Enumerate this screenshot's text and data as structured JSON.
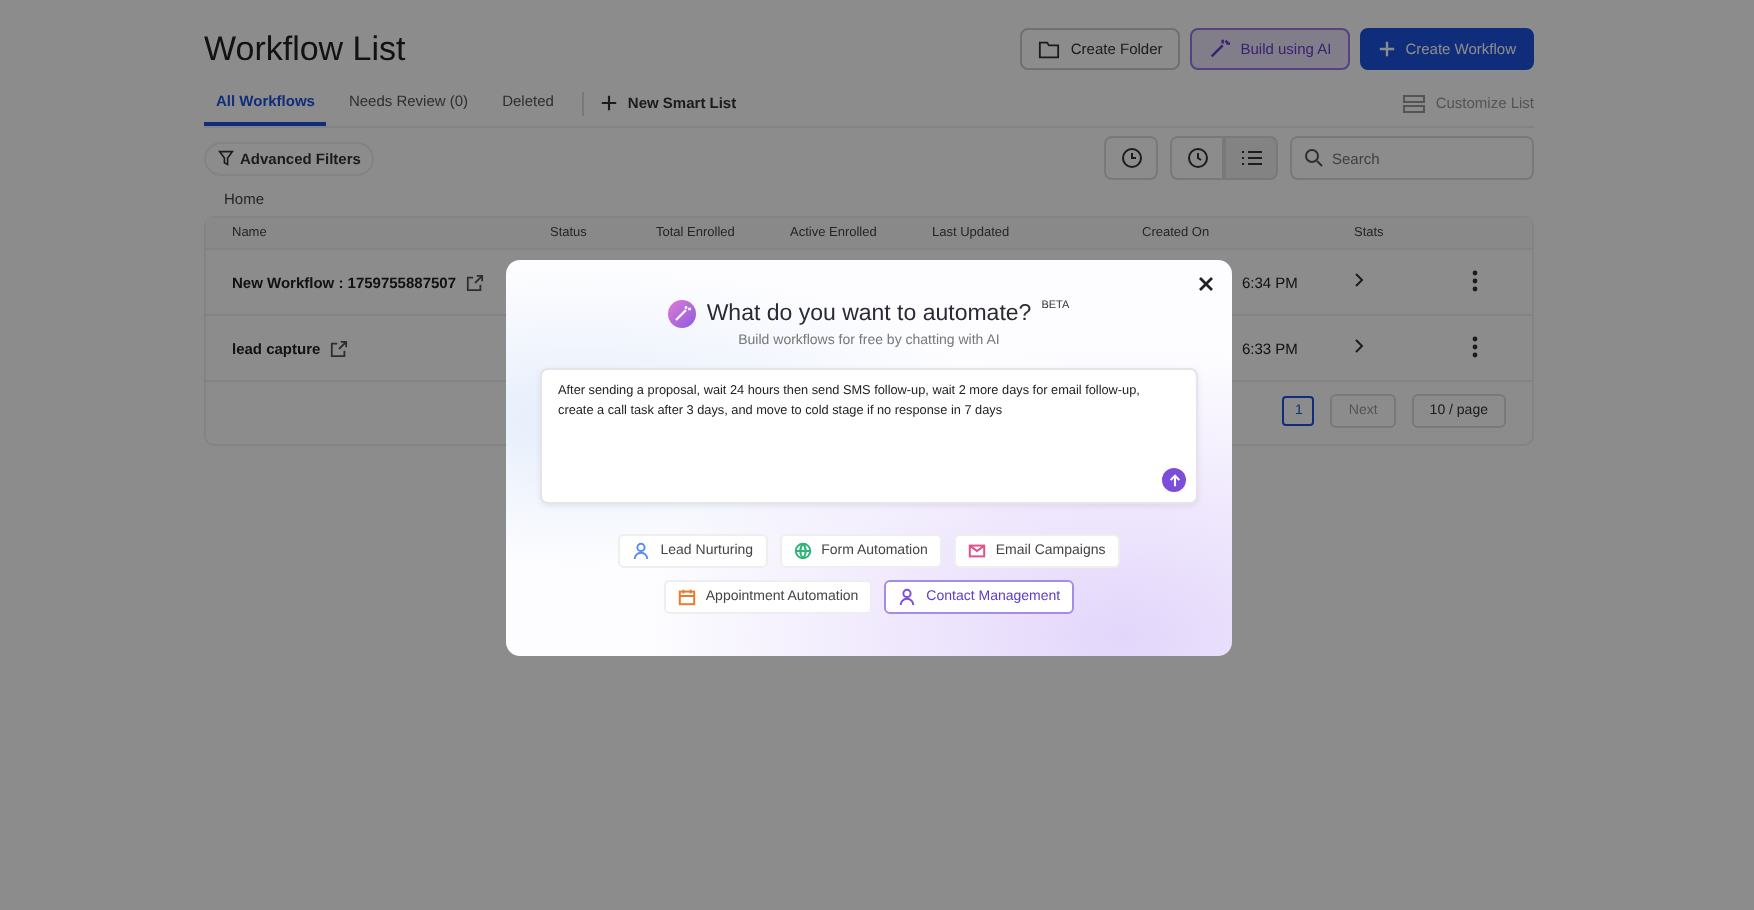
{
  "page": {
    "title": "Workflow List",
    "header_buttons": [
      {
        "label": "Create Folder",
        "kind": "folder"
      },
      {
        "label": "Build using AI",
        "kind": "ai"
      },
      {
        "label": "Create Workflow",
        "kind": "primary"
      }
    ],
    "tabs": [
      {
        "label": "All Workflows",
        "selected": true
      },
      {
        "label": "Needs Review (0)",
        "selected": false
      },
      {
        "label": "Deleted",
        "selected": false
      }
    ],
    "new_smart_list": "New Smart List",
    "customize_list": "Customize List",
    "advanced_filters": "Advanced Filters",
    "search": {
      "placeholder": "Search"
    },
    "breadcrumb": "Home",
    "table": {
      "columns": [
        "Name",
        "Status",
        "Total Enrolled",
        "Active Enrolled",
        "Last Updated",
        "Created On",
        "Stats"
      ],
      "rows": [
        {
          "name": "New Workflow : 1759755887507",
          "created_on": "6:34 PM"
        },
        {
          "name": "lead capture",
          "created_on": "6:33 PM"
        }
      ]
    },
    "pagination": {
      "page": "1",
      "next": "Next",
      "page_size": "10 / page"
    }
  },
  "modal": {
    "title": "What do you want to automate?",
    "badge": "BETA",
    "subtitle": "Build workflows for free by chatting with AI",
    "prompt": "After sending a proposal, wait 24 hours then send SMS follow-up, wait 2 more days for email follow-up, create a call task after 3 days, and move to cold stage if no response in 7 days",
    "chips": [
      {
        "label": "Lead Nurturing",
        "kind": "person",
        "color": "#5b8def",
        "selected": false
      },
      {
        "label": "Form Automation",
        "kind": "form",
        "color": "#2fb57a",
        "selected": false
      },
      {
        "label": "Email Campaigns",
        "kind": "mail",
        "color": "#e0508a",
        "selected": false
      },
      {
        "label": "Appointment Automation",
        "kind": "calendar",
        "color": "#ec7a2e",
        "selected": false
      },
      {
        "label": "Contact Management",
        "kind": "person",
        "color": "#7c4ddb",
        "selected": true
      }
    ]
  }
}
